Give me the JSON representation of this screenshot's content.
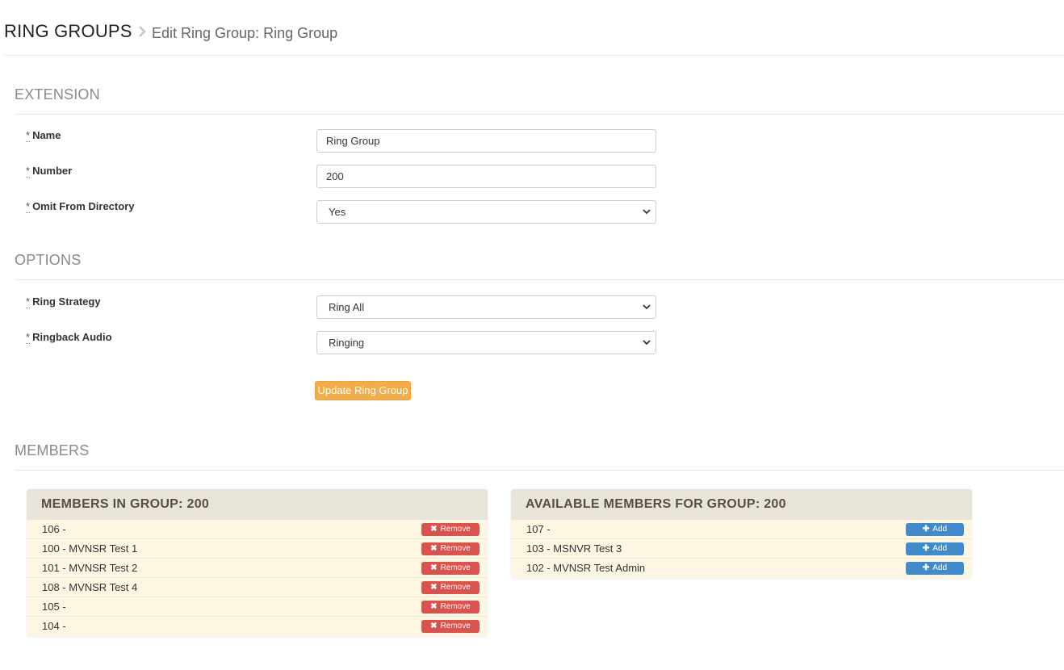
{
  "header": {
    "title": "RING GROUPS",
    "subtitle": "Edit Ring Group: Ring Group"
  },
  "sections": {
    "extension": "EXTENSION",
    "options": "OPTIONS",
    "members": "MEMBERS"
  },
  "required_marker": "*",
  "fields": {
    "name": {
      "label": "Name",
      "value": "Ring Group"
    },
    "number": {
      "label": "Number",
      "value": "200"
    },
    "omit_from_directory": {
      "label": "Omit From Directory",
      "value": "Yes"
    },
    "ring_strategy": {
      "label": "Ring Strategy",
      "value": "Ring All"
    },
    "ringback_audio": {
      "label": "Ringback Audio",
      "value": "Ringing"
    }
  },
  "update_button": "Update Ring Group",
  "members_in_group": {
    "title": "MEMBERS IN GROUP: 200",
    "button_label": "Remove",
    "items": [
      "106 -",
      "100 - MVNSR Test 1",
      "101 - MVNSR Test 2",
      "108 - MVNSR Test 4",
      "105 -",
      "104 -"
    ]
  },
  "available_members": {
    "title": "AVAILABLE MEMBERS FOR GROUP: 200",
    "button_label": "Add",
    "items": [
      "107 -",
      "103 - MSNVR Test 3",
      "102 - MVNSR Test Admin"
    ]
  },
  "colors": {
    "update_button": "#f0ad4e",
    "remove_button": "#d9534f",
    "add_button": "#428bca",
    "panel_header": "#e8e4da",
    "panel_body": "#fdf6e3"
  }
}
